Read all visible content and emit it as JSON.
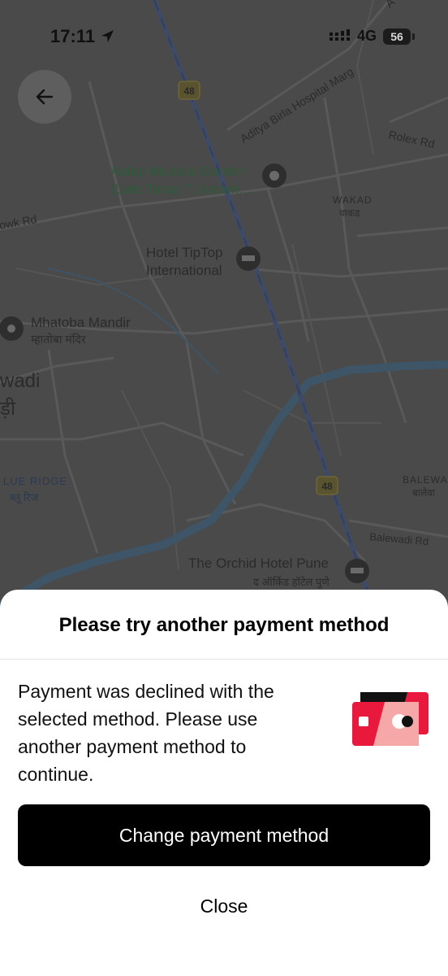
{
  "status_bar": {
    "time": "17:11",
    "network": "4G",
    "battery": "56"
  },
  "map": {
    "labels": {
      "hospital_marg": "Aditya Birla Hospital Marg",
      "rolex_rd": "Rolex Rd",
      "aalap_1": "Aalap Musical Garden",
      "aalap_2": "(Late Tanaji Tukaram...",
      "wakad": "WAKAD",
      "wakad_hi": "वाकड",
      "chowk_rd": "owk Rd",
      "hotel_tiptop_1": "Hotel TipTop",
      "hotel_tiptop_2": "International",
      "mhatoba": "Mhatoba Mandir",
      "mhatoba_hi": "म्हातोबा मंदिर",
      "wadi": "wadi",
      "wadi_hi": "ड़ी",
      "blue_ridge": "LUE RIDGE",
      "blue_ridge_hi": "ब्लू रिज",
      "balewadi": "BALEWA",
      "balewadi_hi": "बालेवा",
      "balewadi_rd": "Balewadi Rd",
      "orchid_hotel": "The Orchid Hotel Pune",
      "orchid_hotel_hi": "द ऑर्किड हॉटेल पुणे",
      "highway_1": "48",
      "highway_2": "48",
      "top_corner": "A"
    }
  },
  "sheet": {
    "title": "Please try another payment method",
    "message": "Payment was declined with the selected method. Please use another payment method to continue.",
    "primary_button": "Change payment method",
    "secondary_button": "Close"
  }
}
